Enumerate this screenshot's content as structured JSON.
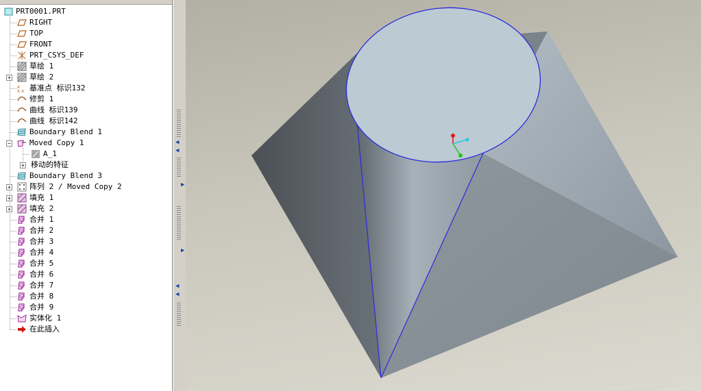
{
  "model_tree": {
    "root_label": "PRT0001.PRT",
    "items": [
      {
        "label": "RIGHT",
        "icon": "datum-plane-icon"
      },
      {
        "label": "TOP",
        "icon": "datum-plane-icon"
      },
      {
        "label": "FRONT",
        "icon": "datum-plane-icon"
      },
      {
        "label": "PRT_CSYS_DEF",
        "icon": "coordinate-system-icon"
      },
      {
        "label": "草绘 1",
        "icon": "sketch-icon"
      },
      {
        "label": "草绘 2",
        "icon": "sketch-icon",
        "expand": "+"
      },
      {
        "label": "基准点 标识132",
        "icon": "datum-point-icon"
      },
      {
        "label": "修剪 1",
        "icon": "curve-icon"
      },
      {
        "label": "曲线 标识139",
        "icon": "curve-icon"
      },
      {
        "label": "曲线 标识142",
        "icon": "curve-icon"
      },
      {
        "label": "Boundary Blend 1",
        "icon": "boundary-blend-icon"
      },
      {
        "label": "Moved Copy 1",
        "icon": "moved-copy-icon",
        "expand": "−"
      },
      {
        "label": "A_1",
        "icon": "surface-thumb-icon",
        "child": true
      },
      {
        "label": "移动的特征",
        "icon": "",
        "child": true,
        "expand": "+"
      },
      {
        "label": "Boundary Blend 3",
        "icon": "boundary-blend-icon"
      },
      {
        "label": "阵列 2 / Moved Copy 2",
        "icon": "pattern-icon",
        "expand": "+"
      },
      {
        "label": "填充 1",
        "icon": "fill-icon",
        "expand": "+"
      },
      {
        "label": "填充 2",
        "icon": "fill-icon",
        "expand": "+"
      },
      {
        "label": "合并 1",
        "icon": "merge-icon"
      },
      {
        "label": "合并 2",
        "icon": "merge-icon"
      },
      {
        "label": "合并 3",
        "icon": "merge-icon"
      },
      {
        "label": "合并 4",
        "icon": "merge-icon"
      },
      {
        "label": "合并 5",
        "icon": "merge-icon"
      },
      {
        "label": "合并 6",
        "icon": "merge-icon"
      },
      {
        "label": "合并 7",
        "icon": "merge-icon"
      },
      {
        "label": "合并 8",
        "icon": "merge-icon"
      },
      {
        "label": "合并 9",
        "icon": "merge-icon"
      },
      {
        "label": "实体化 1",
        "icon": "solidify-icon"
      },
      {
        "label": "在此插入",
        "icon": "insert-here-arrow-icon"
      }
    ]
  },
  "colors": {
    "face_dark": "#4b5156",
    "face_light": "#8d979f",
    "top_face": "#bccad3",
    "edge_highlight": "#2b2bdc"
  }
}
